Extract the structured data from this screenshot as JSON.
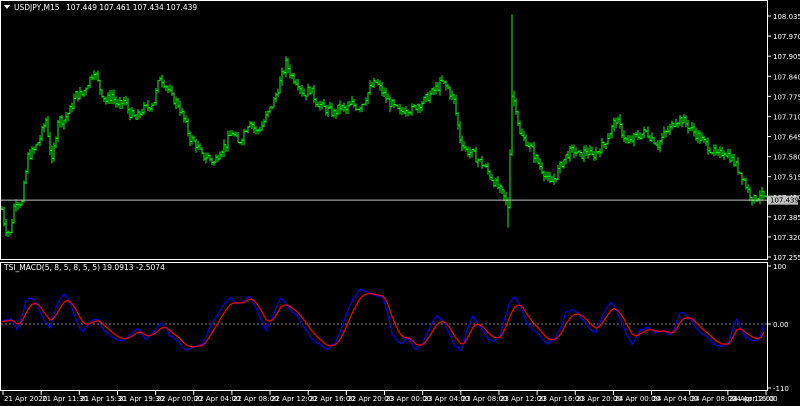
{
  "main_panel": {
    "title": "USDJPY,M15",
    "ohlc_text": "107.449 107.461 107.434 107.439",
    "price_ticks": [
      "108.035",
      "107.970",
      "107.905",
      "107.840",
      "107.775",
      "107.710",
      "107.645",
      "107.580",
      "107.515",
      "107.450",
      "107.385",
      "107.320",
      "107.255"
    ],
    "current_price_label": "107.439",
    "current_price": 107.439,
    "bar_color": "#00ff00",
    "price_line_color": "#c0c0c0"
  },
  "indicator_panel": {
    "title": "TSI_MACD(5, 8, 5, 8, 5, 5) 19.0913 -2.5074",
    "y_ticks": [
      "100",
      "0.00",
      "-110"
    ],
    "line1_color": "#0000ff",
    "line2_color": "#ff0000",
    "zero_line_color": "#808080"
  },
  "time_axis": {
    "labels": [
      "21 Apr 2020",
      "21 Apr 11:30",
      "21 Apr 15:30",
      "21 Apr 19:30",
      "22 Apr 00:00",
      "22 Apr 04:00",
      "22 Apr 08:00",
      "22 Apr 12:00",
      "22 Apr 16:00",
      "22 Apr 20:00",
      "23 Apr 00:00",
      "23 Apr 04:00",
      "23 Apr 08:00",
      "23 Apr 12:00",
      "23 Apr 16:00",
      "23 Apr 20:00",
      "24 Apr 00:00",
      "24 Apr 04:00",
      "24 Apr 08:00",
      "24 Apr 12:00",
      "24 Apr 16:00"
    ]
  },
  "chart_data": {
    "type": "line",
    "title": "USDJPY,M15",
    "ylim": [
      107.255,
      108.06
    ],
    "price_anchors": [
      [
        0,
        107.45
      ],
      [
        5,
        107.35
      ],
      [
        10,
        107.33
      ],
      [
        15,
        107.44
      ],
      [
        22,
        107.43
      ],
      [
        28,
        107.58
      ],
      [
        34,
        107.6
      ],
      [
        40,
        107.64
      ],
      [
        46,
        107.7
      ],
      [
        52,
        107.56
      ],
      [
        58,
        107.7
      ],
      [
        64,
        107.7
      ],
      [
        70,
        107.73
      ],
      [
        76,
        107.78
      ],
      [
        82,
        107.78
      ],
      [
        88,
        107.82
      ],
      [
        94,
        107.86
      ],
      [
        100,
        107.8
      ],
      [
        106,
        107.76
      ],
      [
        112,
        107.78
      ],
      [
        118,
        107.74
      ],
      [
        124,
        107.76
      ],
      [
        130,
        107.72
      ],
      [
        136,
        107.7
      ],
      [
        142,
        107.73
      ],
      [
        148,
        107.74
      ],
      [
        154,
        107.76
      ],
      [
        160,
        107.84
      ],
      [
        166,
        107.81
      ],
      [
        172,
        107.77
      ],
      [
        178,
        107.75
      ],
      [
        184,
        107.7
      ],
      [
        190,
        107.64
      ],
      [
        196,
        107.62
      ],
      [
        202,
        107.58
      ],
      [
        208,
        107.58
      ],
      [
        214,
        107.56
      ],
      [
        220,
        107.6
      ],
      [
        226,
        107.62
      ],
      [
        232,
        107.66
      ],
      [
        238,
        107.62
      ],
      [
        244,
        107.66
      ],
      [
        250,
        107.7
      ],
      [
        256,
        107.66
      ],
      [
        262,
        107.68
      ],
      [
        268,
        107.72
      ],
      [
        274,
        107.76
      ],
      [
        280,
        107.82
      ],
      [
        286,
        107.88
      ],
      [
        292,
        107.84
      ],
      [
        298,
        107.82
      ],
      [
        304,
        107.78
      ],
      [
        310,
        107.8
      ],
      [
        316,
        107.76
      ],
      [
        322,
        107.74
      ],
      [
        328,
        107.73
      ],
      [
        334,
        107.72
      ],
      [
        340,
        107.74
      ],
      [
        346,
        107.73
      ],
      [
        352,
        107.75
      ],
      [
        358,
        107.74
      ],
      [
        364,
        107.76
      ],
      [
        370,
        107.8
      ],
      [
        376,
        107.82
      ],
      [
        382,
        107.79
      ],
      [
        388,
        107.76
      ],
      [
        394,
        107.74
      ],
      [
        400,
        107.72
      ],
      [
        406,
        107.74
      ],
      [
        412,
        107.73
      ],
      [
        418,
        107.75
      ],
      [
        424,
        107.76
      ],
      [
        430,
        107.78
      ],
      [
        436,
        107.8
      ],
      [
        442,
        107.82
      ],
      [
        448,
        107.8
      ],
      [
        454,
        107.76
      ],
      [
        460,
        107.64
      ],
      [
        466,
        107.6
      ],
      [
        472,
        107.59
      ],
      [
        478,
        107.57
      ],
      [
        484,
        107.55
      ],
      [
        490,
        107.52
      ],
      [
        496,
        107.49
      ],
      [
        502,
        107.46
      ],
      [
        508,
        107.42
      ],
      [
        512,
        107.78
      ],
      [
        516,
        107.74
      ],
      [
        520,
        107.65
      ],
      [
        526,
        107.63
      ],
      [
        532,
        107.6
      ],
      [
        538,
        107.56
      ],
      [
        544,
        107.53
      ],
      [
        550,
        107.49
      ],
      [
        556,
        107.52
      ],
      [
        562,
        107.56
      ],
      [
        568,
        107.59
      ],
      [
        574,
        107.6
      ],
      [
        580,
        107.58
      ],
      [
        586,
        107.6
      ],
      [
        592,
        107.58
      ],
      [
        598,
        107.6
      ],
      [
        604,
        107.62
      ],
      [
        610,
        107.66
      ],
      [
        616,
        107.7
      ],
      [
        622,
        107.66
      ],
      [
        628,
        107.62
      ],
      [
        634,
        107.64
      ],
      [
        640,
        107.65
      ],
      [
        646,
        107.66
      ],
      [
        652,
        107.64
      ],
      [
        658,
        107.62
      ],
      [
        664,
        107.65
      ],
      [
        670,
        107.67
      ],
      [
        676,
        107.7
      ],
      [
        682,
        107.7
      ],
      [
        688,
        107.68
      ],
      [
        694,
        107.66
      ],
      [
        700,
        107.64
      ],
      [
        706,
        107.62
      ],
      [
        712,
        107.6
      ],
      [
        718,
        107.58
      ],
      [
        724,
        107.6
      ],
      [
        730,
        107.58
      ],
      [
        736,
        107.55
      ],
      [
        742,
        107.52
      ],
      [
        748,
        107.47
      ],
      [
        754,
        107.44
      ],
      [
        760,
        107.46
      ],
      [
        766,
        107.44
      ]
    ],
    "tsi_anchors": [
      [
        0,
        2
      ],
      [
        10,
        10
      ],
      [
        18,
        -10
      ],
      [
        26,
        40
      ],
      [
        34,
        48
      ],
      [
        42,
        12
      ],
      [
        50,
        -5
      ],
      [
        58,
        40
      ],
      [
        66,
        52
      ],
      [
        74,
        18
      ],
      [
        82,
        -15
      ],
      [
        90,
        5
      ],
      [
        98,
        8
      ],
      [
        106,
        -15
      ],
      [
        114,
        -25
      ],
      [
        122,
        -30
      ],
      [
        130,
        -20
      ],
      [
        138,
        -5
      ],
      [
        146,
        -25
      ],
      [
        154,
        -15
      ],
      [
        162,
        5
      ],
      [
        170,
        -20
      ],
      [
        178,
        -30
      ],
      [
        186,
        -45
      ],
      [
        194,
        -40
      ],
      [
        202,
        -35
      ],
      [
        210,
        -5
      ],
      [
        220,
        25
      ],
      [
        230,
        45
      ],
      [
        240,
        35
      ],
      [
        250,
        50
      ],
      [
        258,
        20
      ],
      [
        266,
        -10
      ],
      [
        272,
        10
      ],
      [
        280,
        45
      ],
      [
        288,
        30
      ],
      [
        296,
        15
      ],
      [
        304,
        -5
      ],
      [
        312,
        -25
      ],
      [
        320,
        -35
      ],
      [
        328,
        -45
      ],
      [
        336,
        -30
      ],
      [
        344,
        5
      ],
      [
        352,
        40
      ],
      [
        360,
        60
      ],
      [
        368,
        55
      ],
      [
        376,
        50
      ],
      [
        384,
        45
      ],
      [
        392,
        -15
      ],
      [
        400,
        -35
      ],
      [
        408,
        -25
      ],
      [
        416,
        -45
      ],
      [
        422,
        -35
      ],
      [
        430,
        -5
      ],
      [
        436,
        15
      ],
      [
        444,
        5
      ],
      [
        450,
        -20
      ],
      [
        456,
        -40
      ],
      [
        462,
        -45
      ],
      [
        468,
        -5
      ],
      [
        474,
        15
      ],
      [
        480,
        -5
      ],
      [
        488,
        -25
      ],
      [
        494,
        -30
      ],
      [
        500,
        -20
      ],
      [
        508,
        30
      ],
      [
        514,
        50
      ],
      [
        520,
        35
      ],
      [
        526,
        5
      ],
      [
        532,
        -10
      ],
      [
        540,
        -20
      ],
      [
        548,
        -35
      ],
      [
        554,
        -25
      ],
      [
        560,
        -10
      ],
      [
        566,
        20
      ],
      [
        572,
        25
      ],
      [
        580,
        15
      ],
      [
        588,
        -5
      ],
      [
        596,
        -15
      ],
      [
        604,
        20
      ],
      [
        612,
        40
      ],
      [
        620,
        10
      ],
      [
        626,
        -15
      ],
      [
        632,
        -35
      ],
      [
        640,
        -10
      ],
      [
        648,
        -5
      ],
      [
        656,
        -15
      ],
      [
        664,
        -10
      ],
      [
        672,
        -20
      ],
      [
        680,
        20
      ],
      [
        688,
        15
      ],
      [
        696,
        -5
      ],
      [
        704,
        -20
      ],
      [
        712,
        -30
      ],
      [
        720,
        -40
      ],
      [
        728,
        -35
      ],
      [
        736,
        10
      ],
      [
        744,
        -20
      ],
      [
        752,
        -30
      ],
      [
        760,
        -25
      ],
      [
        766,
        19
      ]
    ]
  }
}
